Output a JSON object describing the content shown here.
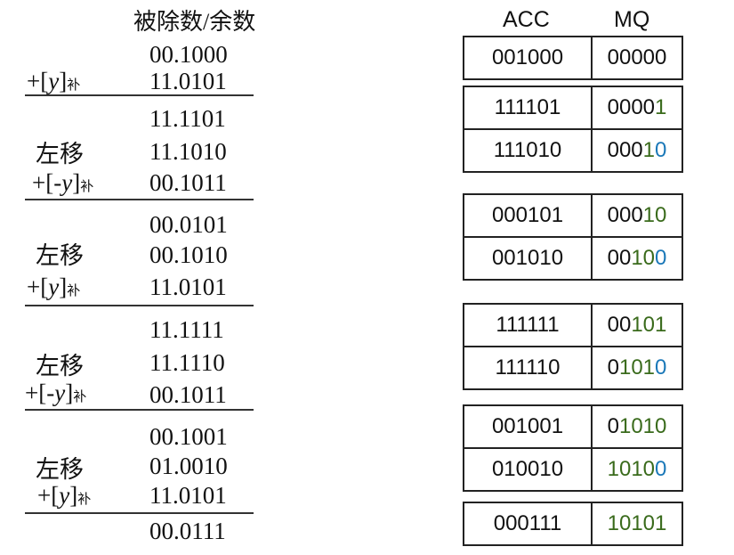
{
  "title": "被除数/余数",
  "headers": {
    "acc": "ACC",
    "mq": "MQ"
  },
  "left_column": {
    "values": [
      "00.1000",
      "11.0101",
      "11.1101",
      "11.1010",
      "00.1011",
      "00.0101",
      "00.1010",
      "11.0101",
      "11.1111",
      "11.1110",
      "00.1011",
      "00.1001",
      "01.0010",
      "11.0101",
      "00.0111"
    ],
    "labels": {
      "add_y": {
        "prefix": "+[",
        "var": "y",
        "suffix": "]",
        "sub": "补"
      },
      "add_neg_y": {
        "prefix": "+[",
        "var": "-y",
        "suffix": "]",
        "sub": "补"
      },
      "shift_left": "左移"
    }
  },
  "register_groups": [
    {
      "rows": [
        {
          "acc": "001000",
          "mq": [
            [
              "00000",
              "dg"
            ]
          ]
        }
      ]
    },
    {
      "rows": [
        {
          "acc": "111101",
          "mq": [
            [
              "0000",
              "dg"
            ],
            [
              "1",
              "dg-green"
            ]
          ]
        },
        {
          "acc": "111010",
          "mq": [
            [
              "000",
              "dg"
            ],
            [
              "1",
              "dg-green"
            ],
            [
              "0",
              "dg-blue"
            ]
          ]
        }
      ]
    },
    {
      "rows": [
        {
          "acc": "000101",
          "mq": [
            [
              "000",
              "dg"
            ],
            [
              "10",
              "dg-green"
            ]
          ]
        },
        {
          "acc": "001010",
          "mq": [
            [
              "00",
              "dg"
            ],
            [
              "10",
              "dg-green"
            ],
            [
              "0",
              "dg-blue"
            ]
          ]
        }
      ]
    },
    {
      "rows": [
        {
          "acc": "111111",
          "mq": [
            [
              "00",
              "dg"
            ],
            [
              "101",
              "dg-green"
            ]
          ]
        },
        {
          "acc": "111110",
          "mq": [
            [
              "0",
              "dg"
            ],
            [
              "101",
              "dg-green"
            ],
            [
              "0",
              "dg-blue"
            ]
          ]
        }
      ]
    },
    {
      "rows": [
        {
          "acc": "001001",
          "mq": [
            [
              "0",
              "dg"
            ],
            [
              "1010",
              "dg-green"
            ]
          ]
        },
        {
          "acc": "010010",
          "mq": [
            [
              "1010",
              "dg-green"
            ],
            [
              "0",
              "dg-blue"
            ]
          ]
        }
      ]
    },
    {
      "rows": [
        {
          "acc": "000111",
          "mq": [
            [
              "10101",
              "dg-green"
            ]
          ]
        }
      ]
    }
  ],
  "colors": {
    "quotient_bit": "#3a6b1c",
    "shifted_in_bit": "#1a78b8",
    "text": "#111111"
  }
}
